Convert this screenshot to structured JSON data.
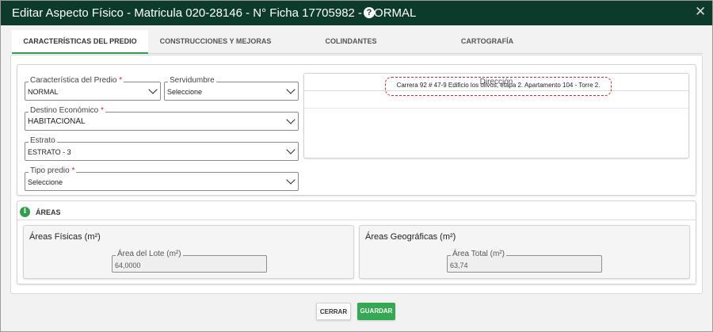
{
  "header": {
    "title": "Editar Aspecto Físico - Matricula 020-28146 - N° Ficha 17705982 - NORMAL",
    "help_symbol": "?",
    "close_symbol": "✕"
  },
  "tabs": [
    {
      "label": "CARACTERÍSTICAS DEL PREDIO",
      "active": true
    },
    {
      "label": "CONSTRUCCIONES Y MEJORAS",
      "active": false
    },
    {
      "label": "COLINDANTES",
      "active": false
    },
    {
      "label": "CARTOGRAFÍA",
      "active": false
    }
  ],
  "form": {
    "caracteristica": {
      "label": "Característica del Predio",
      "required": "*",
      "value": "NORMAL"
    },
    "servidumbre": {
      "label": "Servidumbre",
      "value": "Seleccione"
    },
    "destino": {
      "label": "Destino Económico",
      "required": "*",
      "value": "HABITACIONAL"
    },
    "estrato": {
      "label": "Estrato",
      "value": "ESTRATO - 3"
    },
    "tipo": {
      "label": "Tipo predio",
      "required": "*",
      "value": "Seleccione"
    }
  },
  "direccion": {
    "header": "Dirección",
    "value": "Carrera 92 # 47-9 Edificio los olivos, etapa 2. Apartamento 104 - Torre 2."
  },
  "areas": {
    "section_title": "ÁREAS",
    "info_symbol": "i",
    "fisicas": {
      "title": "Áreas Físicas (m²)",
      "field_label": "Área del Lote (m²)",
      "value": "64,0000"
    },
    "geograficas": {
      "title": "Áreas Geográficas (m²)",
      "field_label": "Área Total (m²)",
      "value": "63,74"
    }
  },
  "footer": {
    "close_label": "CERRAR",
    "save_label": "GUARDAR"
  },
  "colors": {
    "header_bg": "#0c3b2c",
    "accent": "#2aa14a",
    "save_bg": "#34a853",
    "highlight": "#d62828"
  }
}
